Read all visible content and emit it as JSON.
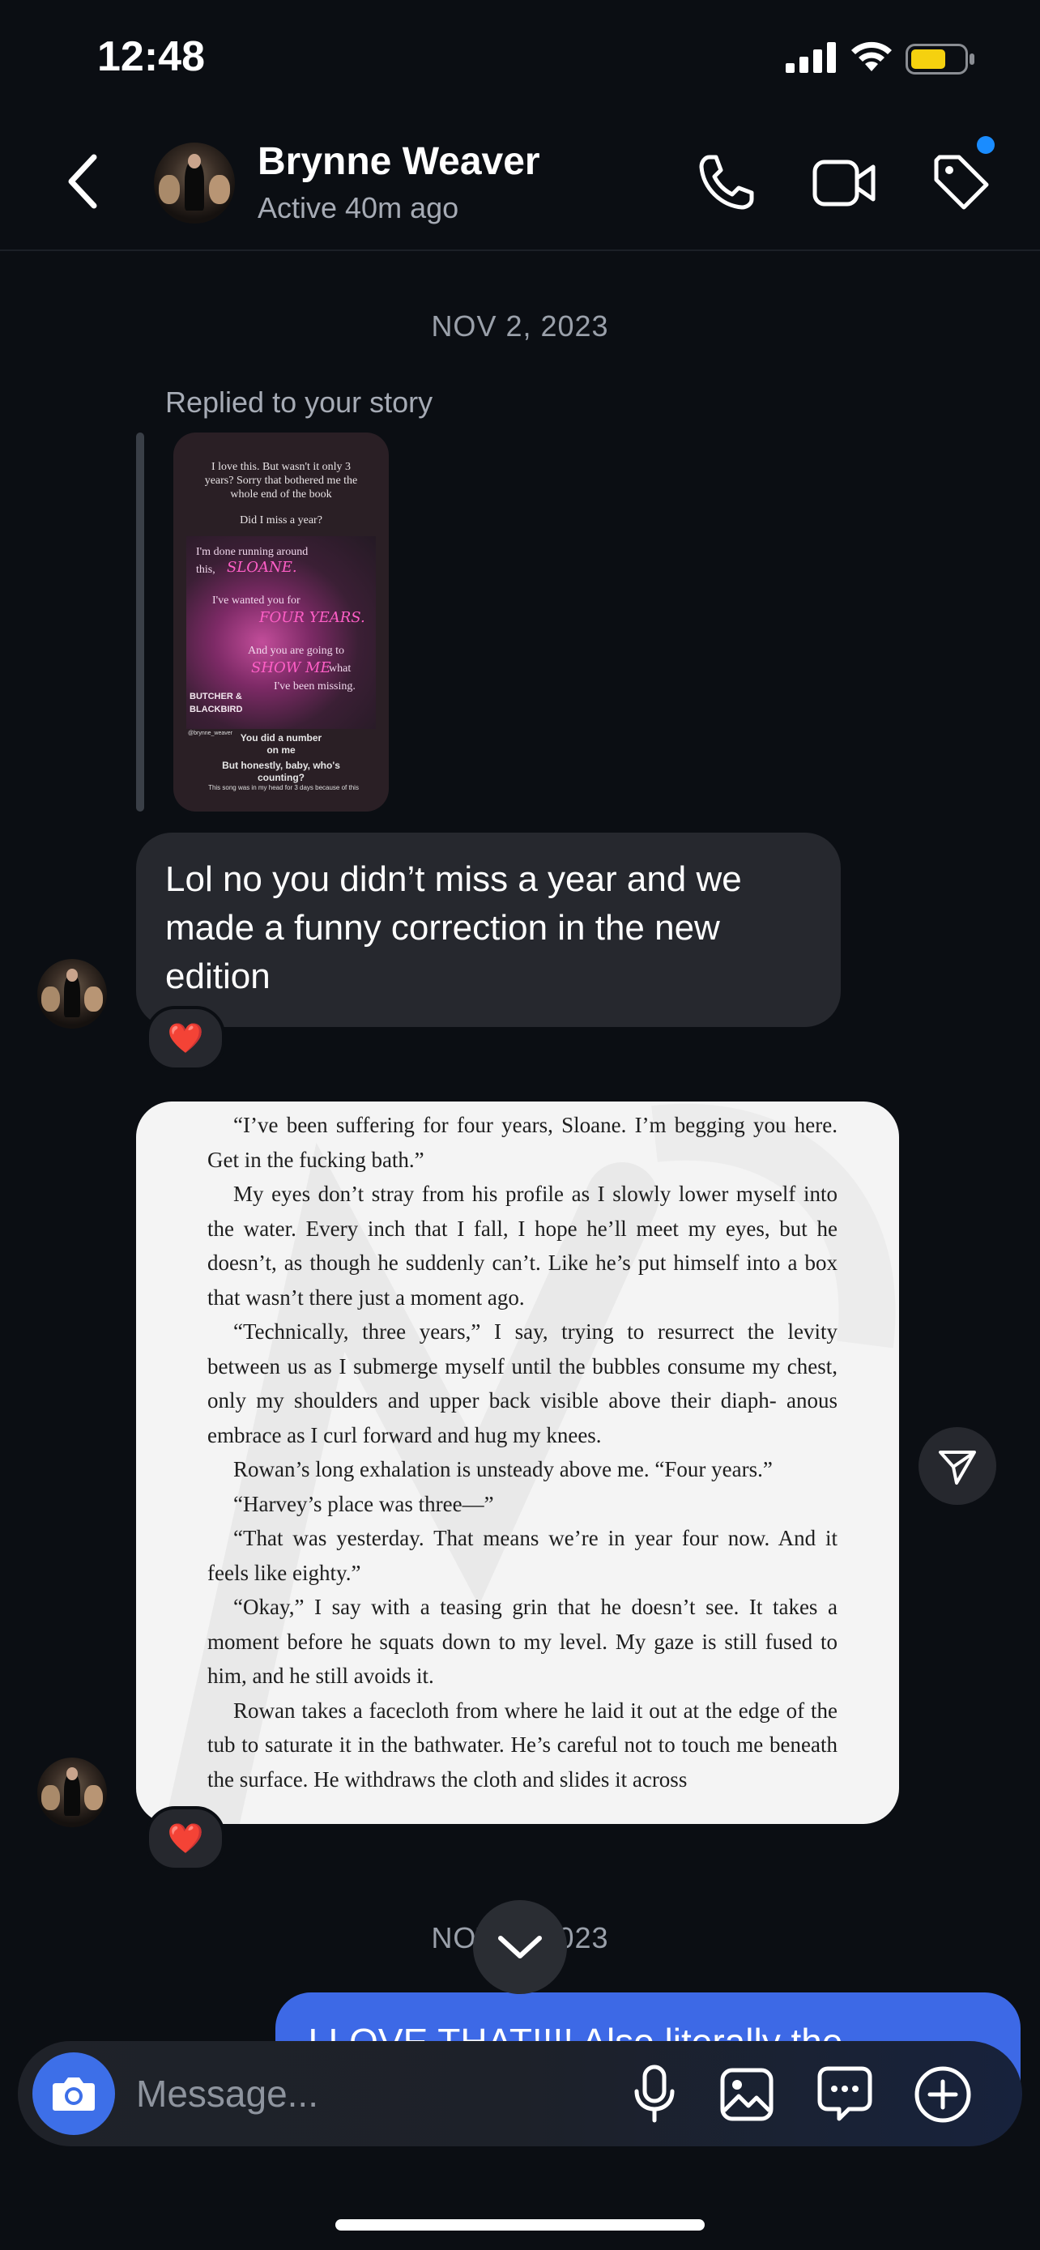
{
  "status_bar": {
    "time": "12:48"
  },
  "header": {
    "contact_name": "Brynne Weaver",
    "contact_status": "Active 40m ago"
  },
  "thread": {
    "date_1": "NOV 2, 2023",
    "replied_label": "Replied to your story",
    "story": {
      "caption_1": "I love this. But wasn't it only 3 years? Sorry that bothered me the whole end of the book",
      "caption_2": "Did I miss a year?",
      "line_1": "I'm done running around",
      "line_2": "this,",
      "name": "SLOANE.",
      "line_3": "I've wanted you for",
      "years": "FOUR YEARS.",
      "line_4": "And you are going to",
      "show": "SHOW ME",
      "line_5": "what",
      "line_6": "I've been missing.",
      "title": "BUTCHER & BLACKBIRD",
      "handle": "@brynne_weaver",
      "bold_1": "You did a number on me",
      "bold_2": "But honestly, baby, who's counting?",
      "footer": "This song was in my head for 3 days because of this"
    },
    "msg_lol": "Lol no you didn’t miss a year and we made a funny correction in the new edition",
    "reaction": "❤️",
    "book_paragraphs": [
      "“I’ve been suffering for four years, Sloane. I’m begging you here. Get in the fucking bath.”",
      "My eyes don’t stray from his profile as I slowly lower myself into the water. Every inch that I fall, I hope he’ll meet my eyes, but he doesn’t, as though he suddenly can’t. Like he’s put himself into a box that wasn’t there just a moment ago.",
      "“Technically, three years,” I say, trying to resurrect the levity between us as I submerge myself until the bubbles consume my chest, only my shoulders and upper back visible above their diaph- anous embrace as I curl forward and hug my knees.",
      "Rowan’s long exhalation is unsteady above me. “Four years.”",
      "“Harvey’s place was three—”",
      "“That was yesterday. That means we’re in year four now. And it feels like eighty.”",
      "“Okay,” I say with a teasing grin that he doesn’t see. It takes a moment before he squats down to my level. My gaze is still fused to him, and he still avoids it.",
      "Rowan takes a facecloth from where he laid it out at the edge of the tub to saturate it in the bathwater. He’s careful not to touch me beneath the surface. He withdraws the cloth and slides it across"
    ],
    "date_2": "NOV 2, 2023",
    "msg_out": "I LOVE THAT!!!! Also literally the"
  },
  "composer": {
    "placeholder": "Message..."
  },
  "icons": {
    "back": "chevron-left-icon",
    "call": "phone-icon",
    "video": "video-camera-icon",
    "tag": "tag-icon",
    "share": "paper-plane-icon",
    "scroll": "chevron-down-icon",
    "camera": "camera-icon",
    "mic": "microphone-icon",
    "gallery": "image-icon",
    "sticker": "chat-bubble-icon",
    "more": "plus-circle-icon"
  },
  "colors": {
    "accent": "#3d69e6",
    "background": "#0b0e13",
    "bubble": "#26282e",
    "notification": "#1a8cff"
  }
}
